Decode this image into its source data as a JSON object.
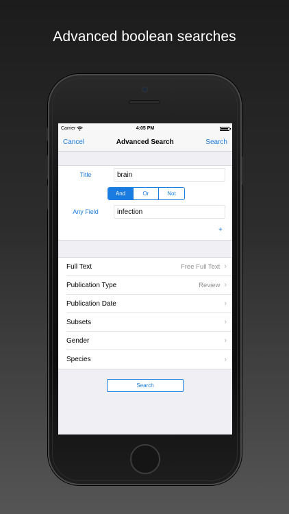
{
  "headline": "Advanced boolean searches",
  "status_bar": {
    "carrier": "Carrier",
    "time": "4:05 PM"
  },
  "nav": {
    "cancel": "Cancel",
    "title": "Advanced Search",
    "search": "Search"
  },
  "query": {
    "rows": [
      {
        "field": "Title",
        "term": "brain"
      },
      {
        "field": "Any Field",
        "term": "infection"
      }
    ],
    "operators": [
      "And",
      "Or",
      "Not"
    ],
    "selected_operator": "And",
    "add_label": "+"
  },
  "filters": [
    {
      "label": "Full Text",
      "value": "Free Full Text"
    },
    {
      "label": "Publication Type",
      "value": "Review"
    },
    {
      "label": "Publication Date",
      "value": ""
    },
    {
      "label": "Subsets",
      "value": ""
    },
    {
      "label": "Gender",
      "value": ""
    },
    {
      "label": "Species",
      "value": ""
    }
  ],
  "search_button": "Search",
  "colors": {
    "accent": "#1a7be0",
    "grouped_bg": "#efeff4"
  },
  "icons": {
    "wifi": "wifi-icon",
    "battery": "battery-icon",
    "chevron": "chevron-right-icon"
  }
}
